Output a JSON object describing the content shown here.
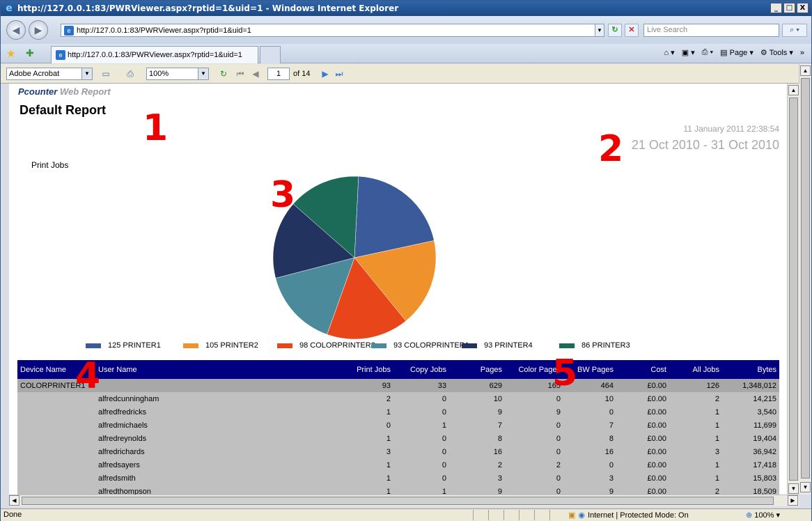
{
  "window": {
    "title": "http://127.0.0.1:83/PWRViewer.aspx?rptid=1&uid=1 - Windows Internet Explorer",
    "min_label": "_",
    "max_label": "□",
    "close_label": "X"
  },
  "addressbar": {
    "url": "http://127.0.0.1:83/PWRViewer.aspx?rptid=1&uid=1",
    "search_placeholder": "Live Search"
  },
  "tabs": [
    {
      "label": "http://127.0.0.1:83/PWRViewer.aspx?rptid=1&uid=1"
    }
  ],
  "commandbar": {
    "page_label": "Page",
    "tools_label": "Tools"
  },
  "report_toolbar": {
    "export_format": "Adobe Acrobat",
    "zoom": "100%",
    "page_current": "1",
    "page_total_text": "of 14"
  },
  "report": {
    "brand_part1": "Pcounter",
    "brand_part2": "Web Report",
    "title": "Default Report",
    "generated": "11 January 2011 22:38:54",
    "date_range": "21 Oct 2010 - 31 Oct 2010",
    "markers": [
      "1",
      "2",
      "3",
      "4",
      "5"
    ]
  },
  "chart_data": {
    "type": "pie",
    "title": "Print Jobs",
    "slices": [
      {
        "label": "125 PRINTER1",
        "value": 125,
        "color": "#3a5a9a"
      },
      {
        "label": "105 PRINTER2",
        "value": 105,
        "color": "#f0922c"
      },
      {
        "label": "98 COLORPRINTER2",
        "value": 98,
        "color": "#e8461a"
      },
      {
        "label": "93 COLORPRINTER1",
        "value": 93,
        "color": "#4a8a9a"
      },
      {
        "label": "93 PRINTER4",
        "value": 93,
        "color": "#233360"
      },
      {
        "label": "86 PRINTER3",
        "value": 86,
        "color": "#1c6b58"
      }
    ],
    "legend_position": "bottom"
  },
  "table": {
    "headers": [
      "Device Name",
      "User Name",
      "Print Jobs",
      "Copy Jobs",
      "Pages",
      "Color Pages",
      "BW Pages",
      "Cost",
      "All Jobs",
      "Bytes"
    ],
    "summary": [
      "COLORPRINTER1",
      "",
      "93",
      "33",
      "629",
      "165",
      "464",
      "£0.00",
      "126",
      "1,348,012"
    ],
    "rows": [
      [
        "",
        "alfredcunningham",
        "2",
        "0",
        "10",
        "0",
        "10",
        "£0.00",
        "2",
        "14,215"
      ],
      [
        "",
        "alfredfredricks",
        "1",
        "0",
        "9",
        "9",
        "0",
        "£0.00",
        "1",
        "3,540"
      ],
      [
        "",
        "alfredmichaels",
        "0",
        "1",
        "7",
        "0",
        "7",
        "£0.00",
        "1",
        "11,699"
      ],
      [
        "",
        "alfredreynolds",
        "1",
        "0",
        "8",
        "0",
        "8",
        "£0.00",
        "1",
        "19,404"
      ],
      [
        "",
        "alfredrichards",
        "3",
        "0",
        "16",
        "0",
        "16",
        "£0.00",
        "3",
        "36,942"
      ],
      [
        "",
        "alfredsayers",
        "1",
        "0",
        "2",
        "2",
        "0",
        "£0.00",
        "1",
        "17,418"
      ],
      [
        "",
        "alfredsmith",
        "1",
        "0",
        "3",
        "0",
        "3",
        "£0.00",
        "1",
        "15,803"
      ],
      [
        "",
        "alfredthompson",
        "1",
        "1",
        "9",
        "0",
        "9",
        "£0.00",
        "2",
        "18,509"
      ]
    ]
  },
  "statusbar": {
    "text": "Done",
    "zone": "Internet | Protected Mode: On",
    "zoom": "100%"
  }
}
